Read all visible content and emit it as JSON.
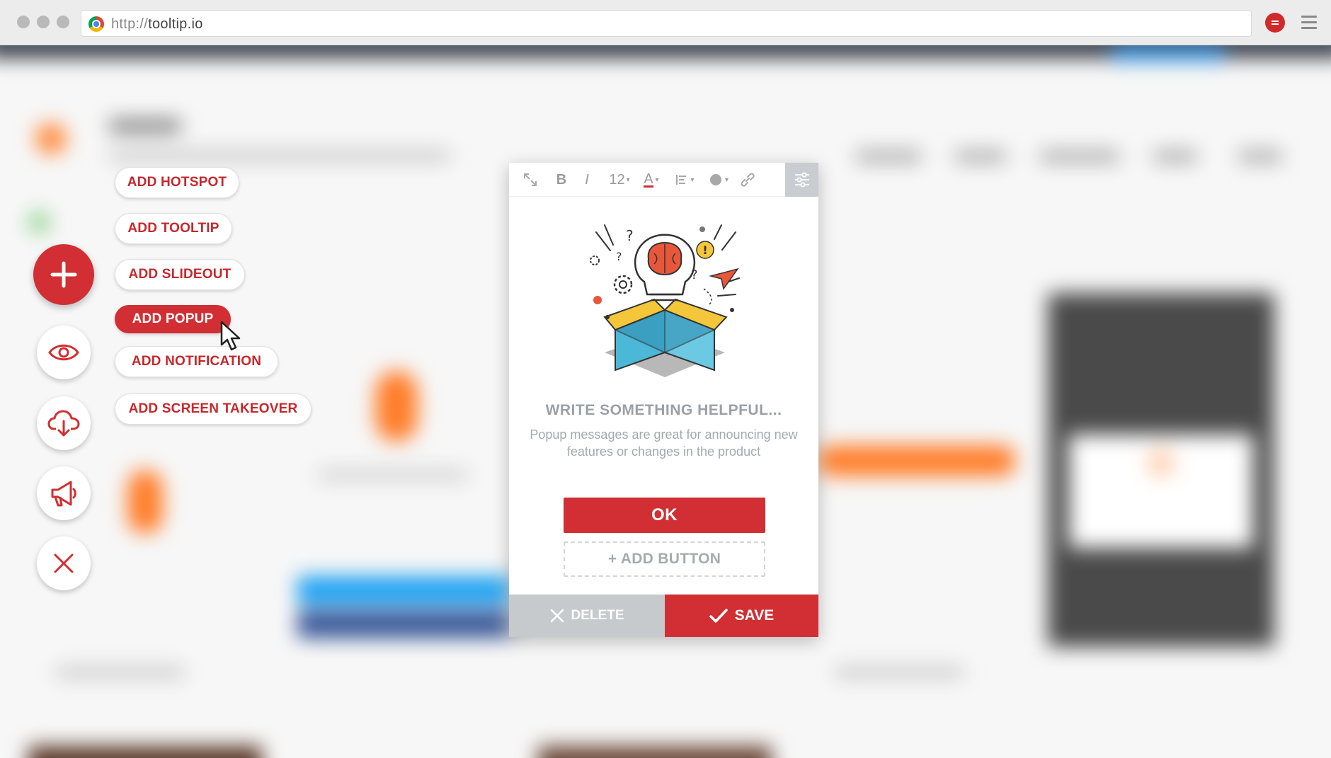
{
  "browser": {
    "url_protocol": "http://",
    "url_host": "tooltip.io"
  },
  "colors": {
    "brand_red": "#d12f33",
    "muted_gray": "#9aa0a6",
    "delete_gray": "#c6cacd"
  },
  "add_menu": {
    "items": [
      {
        "label": "ADD HOTSPOT"
      },
      {
        "label": "ADD TOOLTIP"
      },
      {
        "label": "ADD SLIDEOUT"
      },
      {
        "label": "ADD POPUP"
      },
      {
        "label": "ADD NOTIFICATION"
      },
      {
        "label": "ADD SCREEN TAKEOVER"
      }
    ],
    "active_item": "ADD POPUP"
  },
  "side_controls": {
    "icons": [
      "plus-icon",
      "eye-icon",
      "cloud-download-icon",
      "megaphone-icon",
      "close-icon"
    ]
  },
  "editor": {
    "toolbar": {
      "expand_icon": "expand-icon",
      "bold": "B",
      "italic": "I",
      "font_size": "12",
      "font_color": "A",
      "align_icon": "align-left-icon",
      "color_dot_icon": "color-dot-icon",
      "link_icon": "link-icon",
      "settings_icon": "sliders-icon"
    },
    "illustration": "idea-box-illustration",
    "title": "WRITE SOMETHING HELPFUL...",
    "body": "Popup messages are great for announcing new features or changes in the product",
    "primary_button": "OK",
    "add_button": "+ ADD BUTTON",
    "delete_label": "DELETE",
    "save_label": "SAVE"
  }
}
